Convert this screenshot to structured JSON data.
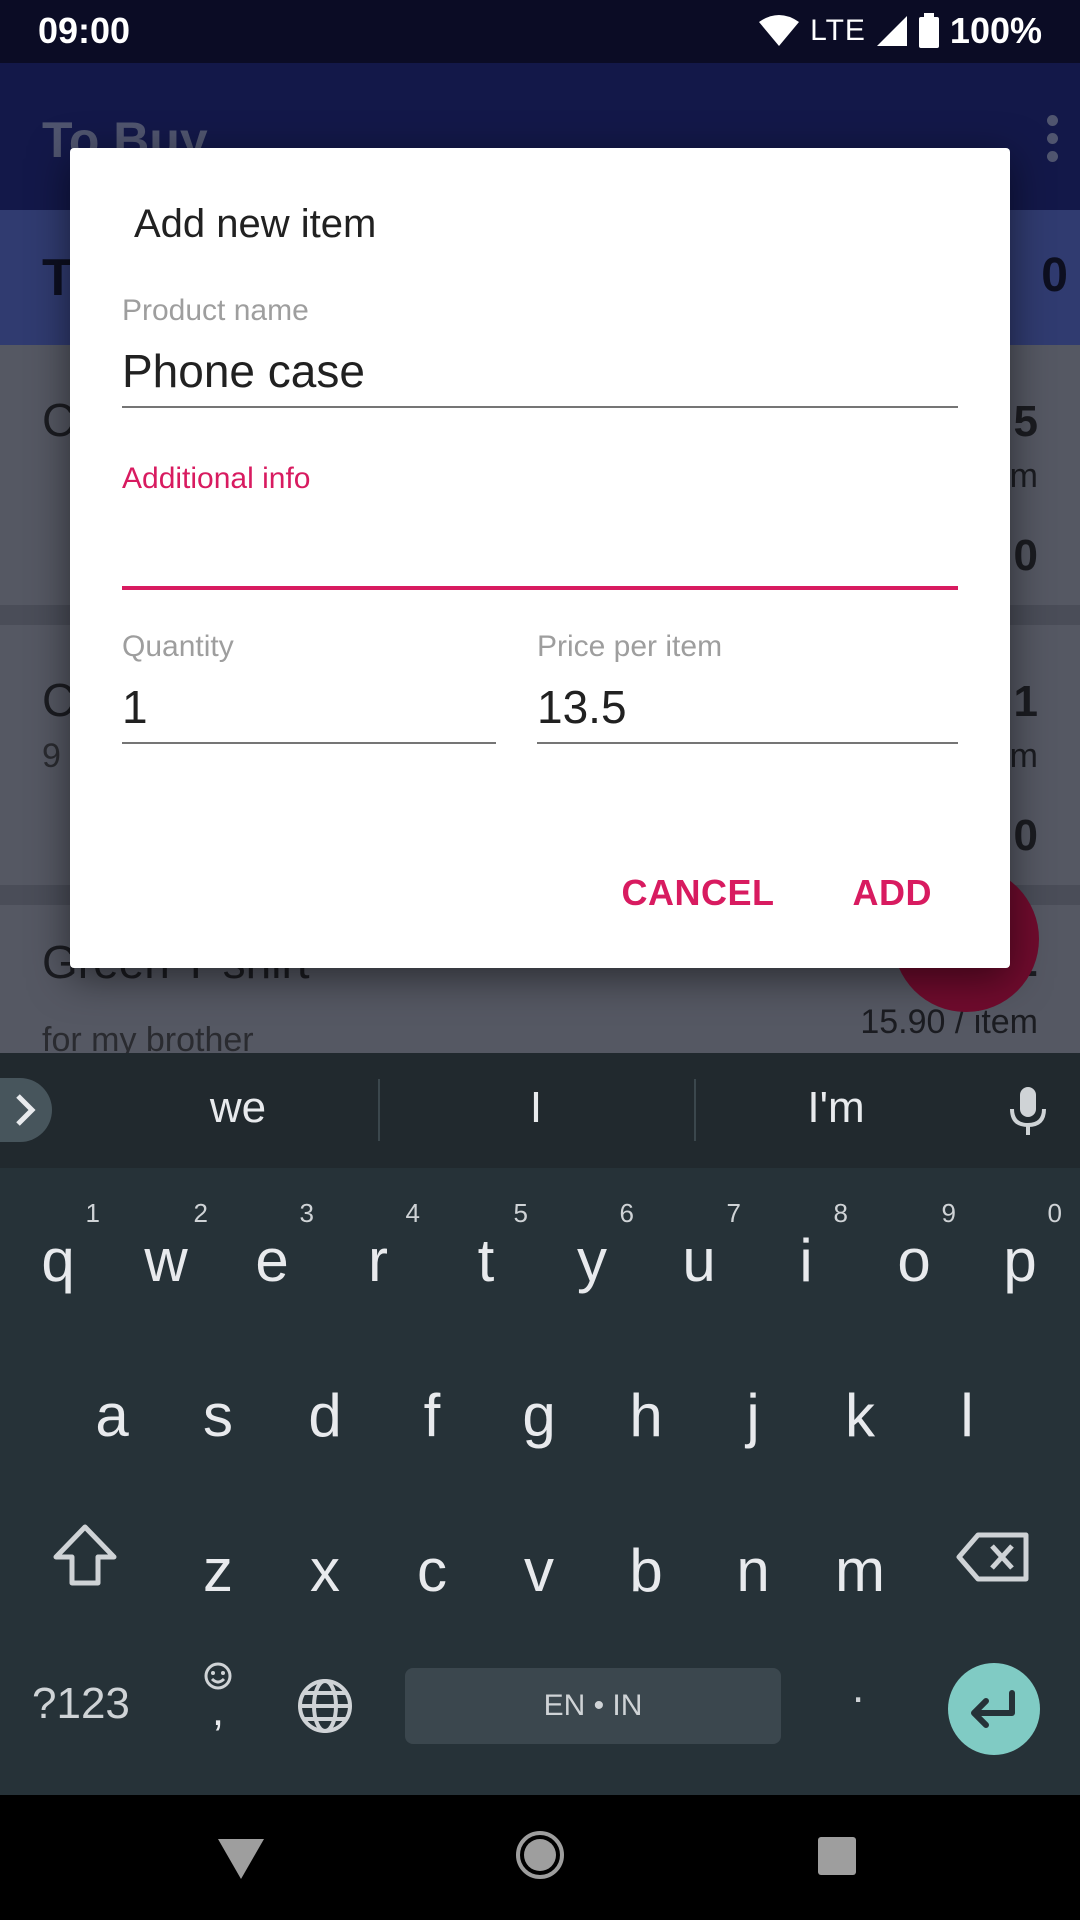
{
  "status_bar": {
    "time": "09:00",
    "network": "LTE",
    "battery": "100%"
  },
  "background_app": {
    "title": "To Buy",
    "summary_title": "T",
    "summary_value": "0",
    "items": [
      {
        "name": "C",
        "info": "",
        "qty": "5",
        "price": "m",
        "total": "0"
      },
      {
        "name": "C",
        "info": "9",
        "qty": "1",
        "price": "m",
        "total": "0"
      },
      {
        "name": "Green T-shirt",
        "info": "for my brother",
        "qty": "2",
        "price": "15.90 / item",
        "total": ""
      }
    ]
  },
  "dialog": {
    "title": "Add new item",
    "product_name_label": "Product name",
    "product_name_value": "Phone case",
    "additional_info_label": "Additional info",
    "additional_info_value": "",
    "quantity_label": "Quantity",
    "quantity_value": "1",
    "price_label": "Price per item",
    "price_value": "13.5",
    "cancel_label": "CANCEL",
    "add_label": "ADD",
    "accent_color": "#d81b60"
  },
  "keyboard": {
    "suggestions": [
      "we",
      "I",
      "I'm"
    ],
    "row1": [
      {
        "ch": "q",
        "num": "1"
      },
      {
        "ch": "w",
        "num": "2"
      },
      {
        "ch": "e",
        "num": "3"
      },
      {
        "ch": "r",
        "num": "4"
      },
      {
        "ch": "t",
        "num": "5"
      },
      {
        "ch": "y",
        "num": "6"
      },
      {
        "ch": "u",
        "num": "7"
      },
      {
        "ch": "i",
        "num": "8"
      },
      {
        "ch": "o",
        "num": "9"
      },
      {
        "ch": "p",
        "num": "0"
      }
    ],
    "row2": [
      "a",
      "s",
      "d",
      "f",
      "g",
      "h",
      "j",
      "k",
      "l"
    ],
    "row3": [
      "z",
      "x",
      "c",
      "v",
      "b",
      "n",
      "m"
    ],
    "symbols_label": "?123",
    "emoji_comma": ",",
    "space_label": "EN • IN",
    "period": ".",
    "icons": [
      "chevron-right-icon",
      "mic-icon",
      "shift-icon",
      "backspace-icon",
      "emoji-icon",
      "globe-icon",
      "enter-icon"
    ]
  },
  "nav_bar": {
    "icons": [
      "back-icon",
      "home-icon",
      "recents-icon"
    ]
  }
}
